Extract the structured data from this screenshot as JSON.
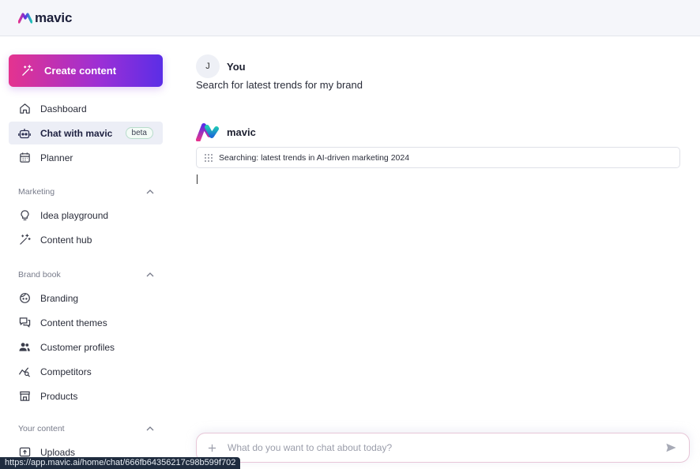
{
  "app": {
    "logo_text": "mavic"
  },
  "sidebar": {
    "create_label": "Create content",
    "items": [
      {
        "label": "Dashboard",
        "icon": "home-icon"
      },
      {
        "label": "Chat with mavic",
        "icon": "robot-icon",
        "badge": "beta",
        "active": true
      },
      {
        "label": "Planner",
        "icon": "calendar-icon"
      }
    ],
    "sections": [
      {
        "title": "Marketing",
        "items": [
          {
            "label": "Idea playground",
            "icon": "lightbulb-icon"
          },
          {
            "label": "Content hub",
            "icon": "magic-wand-icon"
          }
        ]
      },
      {
        "title": "Brand book",
        "items": [
          {
            "label": "Branding",
            "icon": "face-icon"
          },
          {
            "label": "Content themes",
            "icon": "chat-bubbles-icon"
          },
          {
            "label": "Customer profiles",
            "icon": "users-icon"
          },
          {
            "label": "Competitors",
            "icon": "trend-chart-icon"
          },
          {
            "label": "Products",
            "icon": "store-icon"
          }
        ]
      },
      {
        "title": "Your content",
        "items": [
          {
            "label": "Uploads",
            "icon": "upload-icon"
          }
        ]
      }
    ]
  },
  "chat": {
    "user": {
      "avatar_initial": "J",
      "name": "You",
      "message": "Search for latest trends for my brand"
    },
    "bot": {
      "name": "mavic",
      "status": "Searching: latest trends in AI-driven marketing 2024"
    },
    "input": {
      "placeholder": "What do you want to chat about today?",
      "value": ""
    }
  },
  "status_bar": {
    "url": "https://app.mavic.ai/home/chat/666fb64356217c98b599f702"
  },
  "colors": {
    "accent_pink": "#e4338f",
    "accent_purple": "#5b2ee6",
    "active_bg": "#eceef6"
  }
}
